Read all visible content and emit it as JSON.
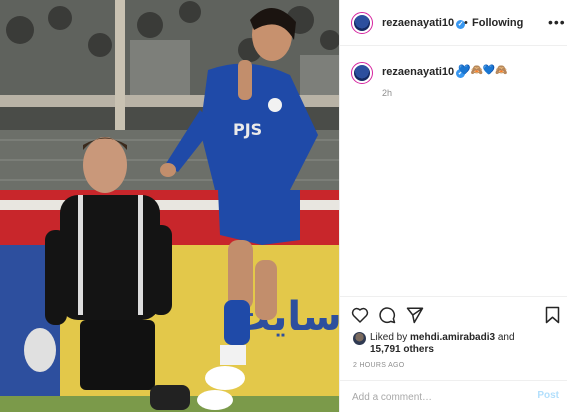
{
  "post": {
    "image_alt": "Football photo: striker in blue kit raising finger, goalkeeper in black kneeling"
  },
  "header": {
    "username": "rezaenayati10",
    "verified_mark": "✓",
    "separator": "•",
    "follow_status": "Following",
    "more_icon": "more-horizontal-icon"
  },
  "caption": {
    "username": "rezaenayati10",
    "verified_mark": "✓",
    "text": "💙🙈💙🙈",
    "time_ago": "2h"
  },
  "actions": {
    "like_icon": "heart-icon",
    "comment_icon": "comment-icon",
    "share_icon": "share-icon",
    "save_icon": "bookmark-icon"
  },
  "likes": {
    "prefix": "Liked by ",
    "user": "mehdi.amirabadi3",
    "middle": " and",
    "count": "15,791 others"
  },
  "posted_time": "2 HOURS AGO",
  "comment": {
    "placeholder": "Add a comment…",
    "post_label": "Post"
  },
  "colors": {
    "accent_blue": "#3897f0",
    "post_disabled": "#b2dffc",
    "border": "#efefef"
  }
}
